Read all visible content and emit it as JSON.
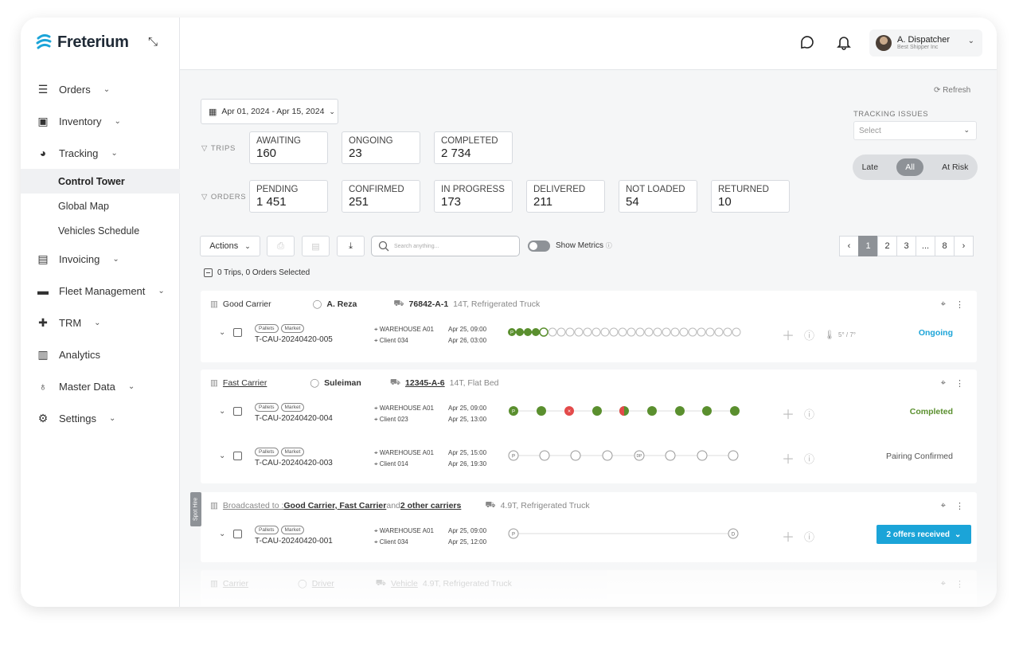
{
  "app": {
    "name": "Freterium"
  },
  "sidebar": {
    "items": [
      {
        "label": "Orders",
        "icon": "list-icon"
      },
      {
        "label": "Inventory",
        "icon": "clipboard-icon"
      },
      {
        "label": "Tracking",
        "icon": "gauge-icon"
      },
      {
        "label": "Invoicing",
        "icon": "document-icon"
      },
      {
        "label": "Fleet Management",
        "icon": "truck-icon"
      },
      {
        "label": "TRM",
        "icon": "puzzle-icon"
      },
      {
        "label": "Analytics",
        "icon": "bar-chart-icon"
      },
      {
        "label": "Master Data",
        "icon": "lightbulb-icon"
      },
      {
        "label": "Settings",
        "icon": "gears-icon"
      }
    ],
    "tracking_sub": [
      "Control Tower",
      "Global Map",
      "Vehicles Schedule"
    ]
  },
  "user": {
    "name": "A. Dispatcher",
    "org": "Best Shipper Inc"
  },
  "toolbar": {
    "refresh": "Refresh",
    "date_range": "Apr 01, 2024 - Apr 15, 2024",
    "trips_label": "TRIPS",
    "orders_label": "ORDERS",
    "actions_label": "Actions",
    "search_placeholder": "Search anything...",
    "show_metrics": "Show Metrics",
    "selected": "0 Trips, 0 Orders Selected"
  },
  "trips_stats": [
    {
      "label": "AWAITING",
      "value": "160"
    },
    {
      "label": "ONGOING",
      "value": "23"
    },
    {
      "label": "COMPLETED",
      "value": "2 734"
    }
  ],
  "orders_stats": [
    {
      "label": "PENDING",
      "value": "1 451"
    },
    {
      "label": "CONFIRMED",
      "value": "251"
    },
    {
      "label": "IN PROGRESS",
      "value": "173"
    },
    {
      "label": "DELIVERED",
      "value": "211"
    },
    {
      "label": "NOT LOADED",
      "value": "54"
    },
    {
      "label": "RETURNED",
      "value": "10"
    }
  ],
  "tracking_issues": {
    "label": "TRACKING ISSUES",
    "placeholder": "Select",
    "segments": [
      "Late",
      "All",
      "At Risk"
    ],
    "active": "All"
  },
  "pagination": [
    "1",
    "2",
    "3",
    "...",
    "8"
  ],
  "colors": {
    "accent": "#1ba4d8",
    "green": "#5a8f2e",
    "red": "#e34a4a",
    "grey": "#8e9297"
  },
  "cards": [
    {
      "carrier": "Good Carrier",
      "driver": "A. Reza",
      "vehicle": "76842-A-1",
      "vehicle_type": "14T, Refrigerated Truck",
      "orders": [
        {
          "id": "T-CAU-20240420-005",
          "tags": [
            "Pallets",
            "Market"
          ],
          "from": "WAREHOUSE A01",
          "to": "Client 034",
          "d1": "Apr 25, 09:00",
          "d2": "Apr 26, 03:00",
          "temp": "5° / 7°",
          "status": "Ongoing",
          "status_color": "#1ba4d8"
        }
      ]
    },
    {
      "carrier": "Fast Carrier",
      "driver": "Suleiman",
      "vehicle": "12345-A-6",
      "vehicle_type": "14T, Flat Bed",
      "orders": [
        {
          "id": "T-CAU-20240420-004",
          "tags": [
            "Pallets",
            "Market"
          ],
          "from": "WAREHOUSE A01",
          "to": "Client 023",
          "d1": "Apr 25, 09:00",
          "d2": "Apr 25, 13:00",
          "status": "Completed",
          "status_color": "#5a8f2e"
        },
        {
          "id": "T-CAU-20240420-003",
          "tags": [
            "Pallets",
            "Market"
          ],
          "from": "WAREHOUSE A01",
          "to": "Client 014",
          "d1": "Apr 25, 15:00",
          "d2": "Apr 26, 19:30",
          "status": "Pairing Confirmed",
          "status_color": "#555555"
        }
      ]
    },
    {
      "broadcast_prefix": "Broadcasted to : ",
      "broadcast_carriers": "Good Carrier, Fast Carrier",
      "broadcast_and": " and ",
      "broadcast_other": "2 other carriers",
      "vehicle_type": "4.9T, Refrigerated Truck",
      "spot": "Spot Hire",
      "orders": [
        {
          "id": "T-CAU-20240420-001",
          "tags": [
            "Pallets",
            "Market"
          ],
          "from": "WAREHOUSE A01",
          "to": "Client 034",
          "d1": "Apr 25, 09:00",
          "d2": "Apr 25, 12:00",
          "offers": "2 offers received"
        }
      ]
    },
    {
      "carrier": "Carrier",
      "driver": "Driver",
      "vehicle": "Vehicle",
      "vehicle_type": "4.9T, Refrigerated Truck"
    }
  ],
  "track_markers": {
    "pickup": "P",
    "dropoff": "D",
    "partial": "DP"
  }
}
